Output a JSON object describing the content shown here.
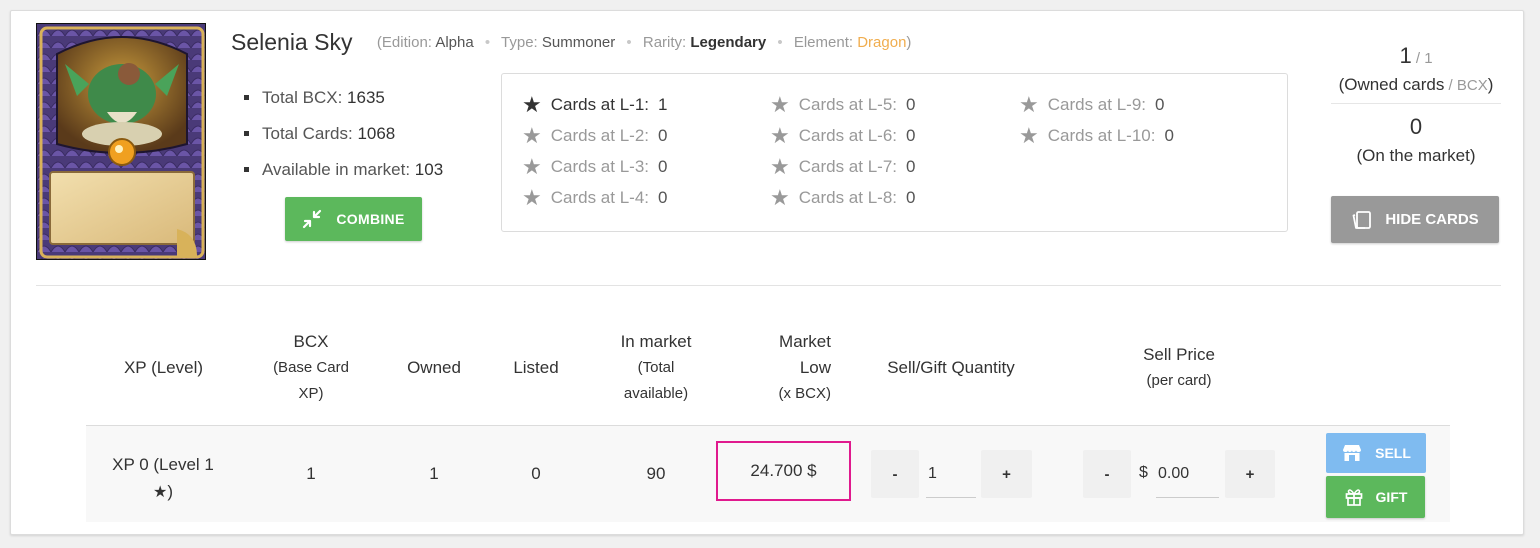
{
  "card": {
    "name": "Selenia Sky",
    "edition_label": "Edition:",
    "edition": "Alpha",
    "type_label": "Type:",
    "type": "Summoner",
    "rarity_label": "Rarity:",
    "rarity": "Legendary",
    "element_label": "Element:",
    "element": "Dragon",
    "element_color": "#f0ad4e",
    "open_paren": "(",
    "close_paren": ")"
  },
  "stats": {
    "total_bcx_label": "Total BCX:",
    "total_bcx": "1635",
    "total_cards_label": "Total Cards:",
    "total_cards": "1068",
    "available_label": "Available in market:",
    "available": "103"
  },
  "combine_label": "COMBINE",
  "levels": [
    {
      "label": "Cards at L-1:",
      "count": "1"
    },
    {
      "label": "Cards at L-2:",
      "count": "0"
    },
    {
      "label": "Cards at L-3:",
      "count": "0"
    },
    {
      "label": "Cards at L-4:",
      "count": "0"
    },
    {
      "label": "Cards at L-5:",
      "count": "0"
    },
    {
      "label": "Cards at L-6:",
      "count": "0"
    },
    {
      "label": "Cards at L-7:",
      "count": "0"
    },
    {
      "label": "Cards at L-8:",
      "count": "0"
    },
    {
      "label": "Cards at L-9:",
      "count": "0"
    },
    {
      "label": "Cards at L-10:",
      "count": "0"
    }
  ],
  "owned": {
    "count": "1",
    "sep": " / ",
    "bcx": "1",
    "label_open": "(Owned cards",
    "label_sep": " / ",
    "label_bcx": "BCX",
    "label_close": ")",
    "market_count": "0",
    "market_label": "(On the market)"
  },
  "hide_cards_label": "HIDE CARDS",
  "table": {
    "headers": {
      "xp": "XP (Level)",
      "bcx_1": "BCX",
      "bcx_2": "(Base Card",
      "bcx_3": "XP)",
      "owned": "Owned",
      "listed": "Listed",
      "in_market_1": "In market",
      "in_market_2": "(Total",
      "in_market_3": "available)",
      "market_low_1": "Market",
      "market_low_2": "Low",
      "market_low_3": "(x BCX)",
      "qty": "Sell/Gift Quantity",
      "price_1": "Sell Price",
      "price_2": "(per card)"
    },
    "row": {
      "xp_1": "XP 0 (Level 1",
      "xp_2": ")",
      "bcx": "1",
      "owned": "1",
      "listed": "0",
      "in_market": "90",
      "market_low": "24.700 $",
      "quantity": "1",
      "currency": "$",
      "price": "0.00"
    },
    "minus": "-",
    "plus": "+",
    "sell_label": "SELL",
    "gift_label": "GIFT"
  }
}
